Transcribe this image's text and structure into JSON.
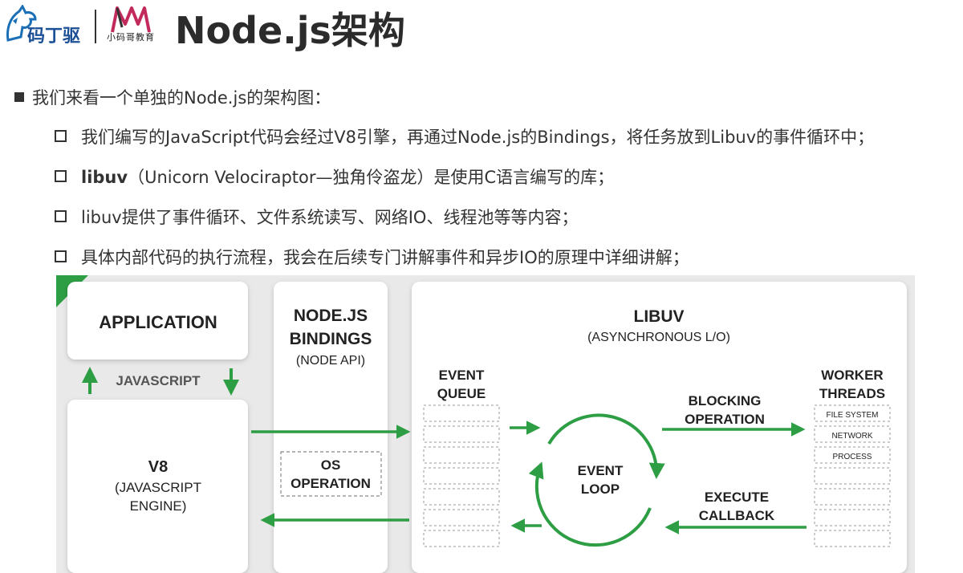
{
  "header": {
    "title": "Node.js架构",
    "logo1_text": "码丁驱",
    "logo2_text": "小码哥教育"
  },
  "bullets": {
    "intro": "我们来看一个单独的Node.js的架构图：",
    "items": [
      {
        "bold": "",
        "text": "我们编写的JavaScript代码会经过V8引擎，再通过Node.js的Bindings，将任务放到Libuv的事件循环中；"
      },
      {
        "bold": "libuv",
        "text": "（Unicorn Velociraptor—独角伶盗龙）是使用C语言编写的库；"
      },
      {
        "bold": "",
        "text": "libuv提供了事件循环、文件系统读写、网络IO、线程池等等内容；"
      },
      {
        "bold": "",
        "text": "具体内部代码的执行流程，我会在后续专门讲解事件和异步IO的原理中详细讲解；"
      }
    ]
  },
  "diagram": {
    "application": "APPLICATION",
    "javascript": "JAVASCRIPT",
    "v8": [
      "V8",
      "(JAVASCRIPT",
      "ENGINE)"
    ],
    "bindings": [
      "NODE.JS",
      "BINDINGS",
      "(NODE API)"
    ],
    "os_operation": [
      "OS",
      "OPERATION"
    ],
    "libuv_title": "LIBUV",
    "libuv_subtitle": "(ASYNCHRONOUS L/O)",
    "event_queue": [
      "EVENT",
      "QUEUE"
    ],
    "event_loop": [
      "EVENT",
      "LOOP"
    ],
    "blocking_operation": [
      "BLOCKING",
      "OPERATION"
    ],
    "execute_callback": [
      "EXECUTE",
      "CALLBACK"
    ],
    "worker_threads": [
      "WORKER",
      "THREADS"
    ],
    "worker_items": [
      "FILE SYSTEM",
      "NETWORK",
      "PROCESS"
    ],
    "accent_color": "#2e9e44"
  }
}
